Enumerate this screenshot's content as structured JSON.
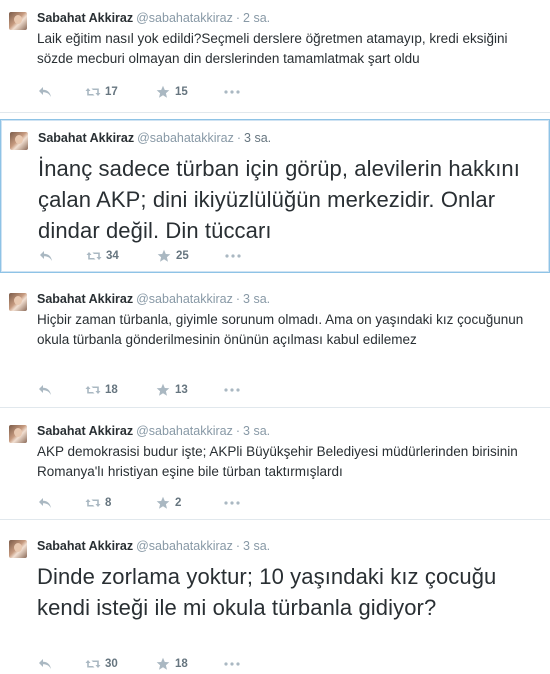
{
  "colors": {
    "border": "#e1e8ed",
    "focus_border": "#8ec3e6",
    "muted": "#8899a6",
    "icon": "#aab8c2",
    "text": "#292f33"
  },
  "tweets": [
    {
      "author": "Sabahat Akkiraz",
      "handle": "@sabahatakkiraz",
      "separator": "·",
      "time": "2 sa.",
      "text": "Laik eğitim nasıl yok edildi?Seçmeli derslere öğretmen atamayıp, kredi eksiğini sözde mecburi olmayan din derslerinden tamamlatmak şart oldu",
      "retweets": "17",
      "favorites": "15",
      "icons": [
        "reply-icon",
        "retweet-icon",
        "favorite-star-icon",
        "more-options-icon"
      ]
    },
    {
      "author": "Sabahat Akkiraz",
      "handle": "@sabahatakkiraz",
      "separator": "·",
      "time": "3 sa.",
      "text": "İnanç sadece türban için görüp, alevilerin hakkını çalan AKP; dini ikiyüzlülüğün merkezidir. Onlar dindar değil. Din tüccarı",
      "retweets": "34",
      "favorites": "25",
      "icons": [
        "reply-icon",
        "retweet-icon",
        "favorite-star-icon",
        "more-options-icon"
      ]
    },
    {
      "author": "Sabahat Akkiraz",
      "handle": "@sabahatakkiraz",
      "separator": "·",
      "time": "3 sa.",
      "text": "Hiçbir zaman türbanla, giyimle sorunum olmadı. Ama on yaşındaki kız çocuğunun okula türbanla gönderilmesinin önünün açılması kabul edilemez",
      "retweets": "18",
      "favorites": "13",
      "icons": [
        "reply-icon",
        "retweet-icon",
        "favorite-star-icon",
        "more-options-icon"
      ]
    },
    {
      "author": "Sabahat Akkiraz",
      "handle": "@sabahatakkiraz",
      "separator": "·",
      "time": "3 sa.",
      "text": "AKP demokrasisi budur işte; AKPli Büyükşehir Belediyesi müdürlerinden birisinin Romanya'lı hristiyan eşine bile türban taktırmışlardı",
      "retweets": "8",
      "favorites": "2",
      "icons": [
        "reply-icon",
        "retweet-icon",
        "favorite-star-icon",
        "more-options-icon"
      ]
    },
    {
      "author": "Sabahat Akkiraz",
      "handle": "@sabahatakkiraz",
      "separator": "·",
      "time": "3 sa.",
      "text": "Dinde zorlama yoktur; 10 yaşındaki kız çocuğu kendi isteği ile mi okula türbanla gidiyor?",
      "retweets": "30",
      "favorites": "18",
      "icons": [
        "reply-icon",
        "retweet-icon",
        "favorite-star-icon",
        "more-options-icon"
      ]
    }
  ]
}
